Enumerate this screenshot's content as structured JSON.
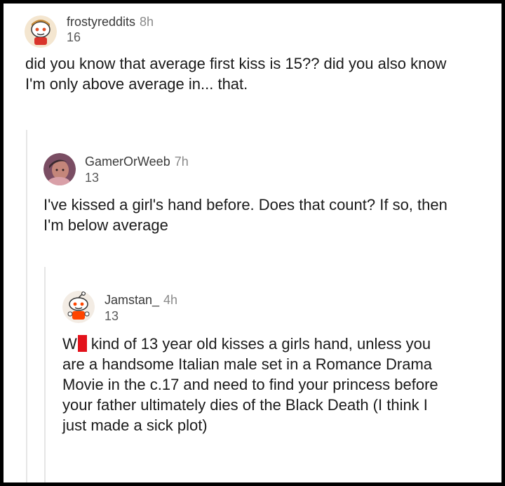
{
  "comments": [
    {
      "username": "frostyreddits",
      "time": "8h",
      "score": "16",
      "lines": [
        "did you know that average first kiss is 15?? did you also know",
        "I'm only above average in... that."
      ]
    },
    {
      "username": "GamerOrWeeb",
      "time": "7h",
      "score": "13",
      "lines": [
        "I've kissed a girl's hand before. Does that count? If so, then",
        "I'm below average"
      ]
    },
    {
      "username": "Jamstan_",
      "time": "4h",
      "score": "13",
      "line1_prefix": "W",
      "line1_rest": " kind of 13 year old kisses a girls hand, unless you",
      "lines": [
        "are a handsome Italian male set in a Romance Drama",
        "Movie in the c.17 and need to find your princess before",
        "your father ultimately dies of the Black Death (I think I",
        "just made a sick plot)"
      ]
    }
  ],
  "colors": {
    "background": "#000000",
    "card": "#ffffff",
    "redaction": "#e3121b"
  },
  "icons": {
    "avatar_1": "snoo-avatar-icon",
    "avatar_2": "user-photo-avatar",
    "avatar_3": "snoo-avatar-icon"
  }
}
